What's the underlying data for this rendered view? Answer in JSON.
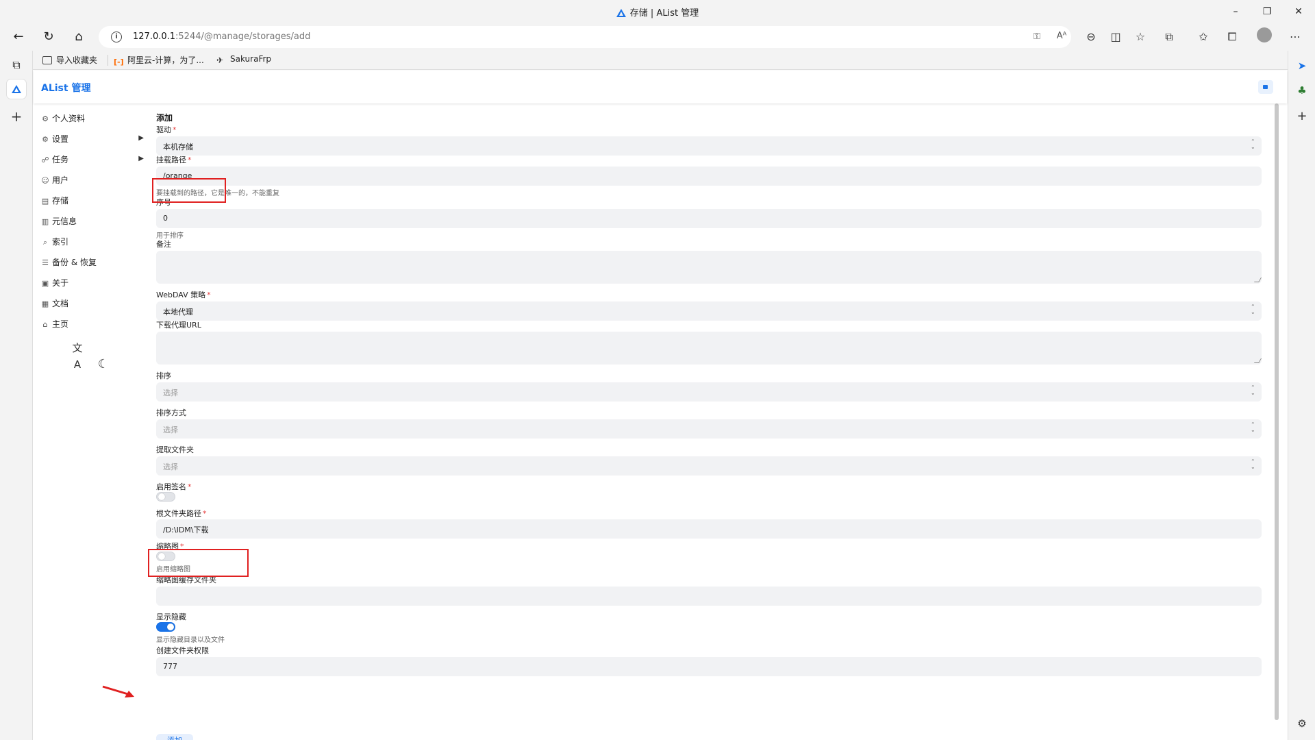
{
  "window": {
    "title": "存储 | AList 管理",
    "minimize": "–",
    "maximize": "❐",
    "close": "✕"
  },
  "browser": {
    "url_host": "127.0.0.1",
    "url_path": ":5244/@manage/storages/add",
    "menu_icon": "⋯",
    "favorites": [
      {
        "label": "导入收藏夹",
        "icon": "import-favorites-icon"
      },
      {
        "label": "阿里云-计算，为了...",
        "icon": "aliyun-icon"
      },
      {
        "label": "SakuraFrp",
        "icon": "sakurafrp-icon"
      }
    ]
  },
  "app": {
    "brand": "AList 管理"
  },
  "sidebar": {
    "items": [
      {
        "label": "个人资料",
        "icon": "⚙"
      },
      {
        "label": "设置",
        "icon": "⚙",
        "has_children": true
      },
      {
        "label": "任务",
        "icon": "☍",
        "has_children": true
      },
      {
        "label": "用户",
        "icon": "☺"
      },
      {
        "label": "存储",
        "icon": "▤"
      },
      {
        "label": "元信息",
        "icon": "▥"
      },
      {
        "label": "索引",
        "icon": "⌕"
      },
      {
        "label": "备份 & 恢复",
        "icon": "☰"
      },
      {
        "label": "关于",
        "icon": "▣"
      },
      {
        "label": "文档",
        "icon": "▦"
      },
      {
        "label": "主页",
        "icon": "⌂"
      }
    ],
    "chevron": "▶",
    "lang_icon": "文A",
    "theme_icon": "☾"
  },
  "form": {
    "heading": "添加",
    "required_mark": "*",
    "driver": {
      "label": "驱动",
      "value": "本机存储"
    },
    "mount_path": {
      "label": "挂载路径",
      "value": "/orange",
      "help": "要挂载到的路径，它是唯一的，不能重复"
    },
    "order": {
      "label": "序号",
      "value": "0",
      "help": "用于排序"
    },
    "remark": {
      "label": "备注",
      "value": ""
    },
    "webdav_policy": {
      "label": "WebDAV 策略",
      "value": "本地代理"
    },
    "download_proxy_url": {
      "label": "下载代理URL",
      "value": ""
    },
    "sort": {
      "label": "排序",
      "placeholder": "选择"
    },
    "sort_direction": {
      "label": "排序方式",
      "placeholder": "选择"
    },
    "extract_folder": {
      "label": "提取文件夹",
      "placeholder": "选择"
    },
    "enable_sign": {
      "label": "启用签名",
      "on": false
    },
    "root_folder_path": {
      "label": "根文件夹路径",
      "value": "/D:\\IDM\\下载"
    },
    "thumbnail": {
      "label": "缩略图",
      "on": false,
      "help": "启用缩略图"
    },
    "thumb_cache_folder": {
      "label": "缩略图缓存文件夹",
      "value": ""
    },
    "show_hidden": {
      "label": "显示隐藏",
      "on": true,
      "help": "显示隐藏目录以及文件"
    },
    "mkdir_perm": {
      "label": "创建文件夹权限",
      "value": "777"
    },
    "submit": "添加"
  }
}
